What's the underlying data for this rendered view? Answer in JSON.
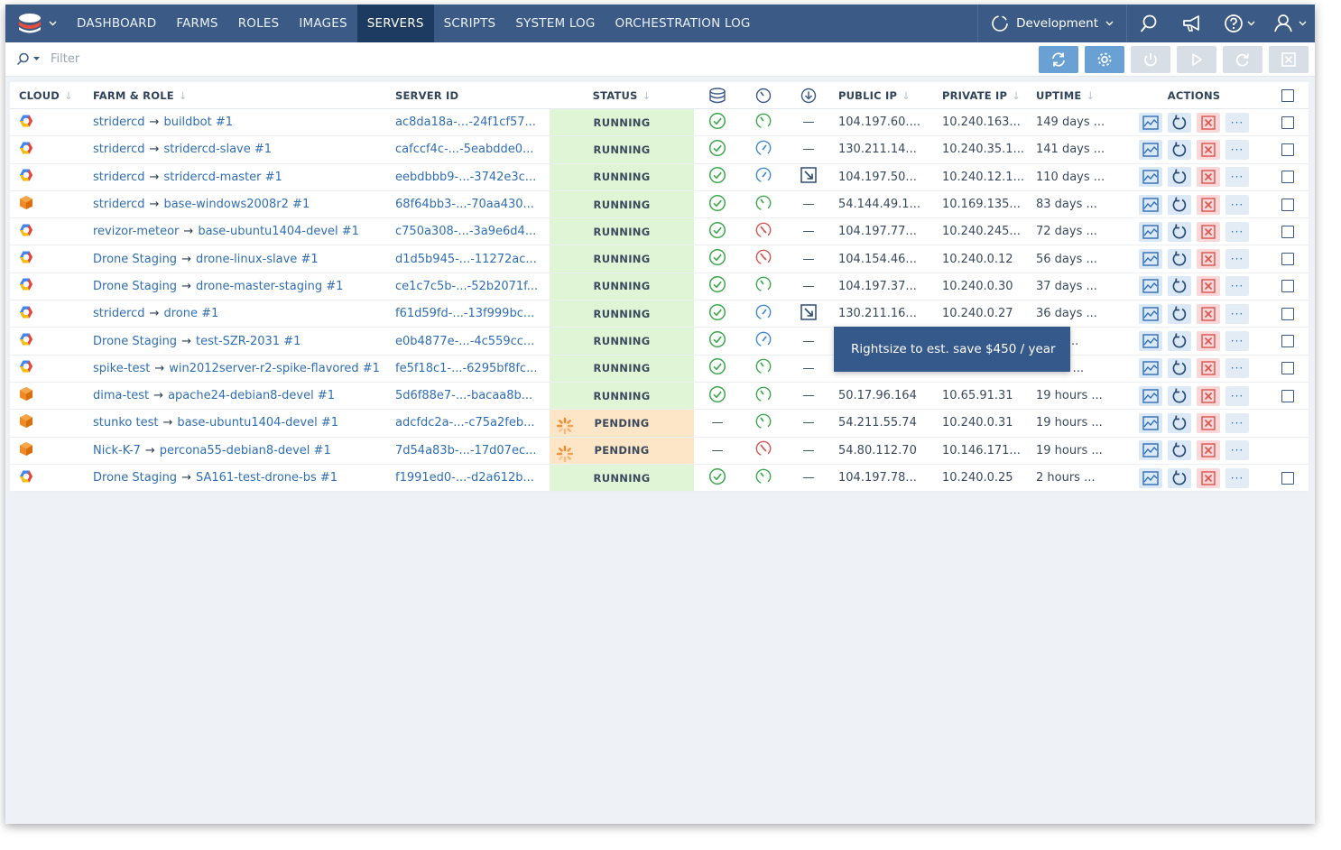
{
  "colors": {
    "nav_bg": "#3b5a85",
    "nav_active": "#1d3a61",
    "link": "#2f6eb5",
    "running_bg": "#dff5d6",
    "pending_bg": "#fde5c7",
    "ok_green": "#3aa84a",
    "warn_red": "#d9534f",
    "info_blue": "#3d8ad6"
  },
  "nav": {
    "items": [
      "DASHBOARD",
      "FARMS",
      "ROLES",
      "IMAGES",
      "SERVERS",
      "SCRIPTS",
      "SYSTEM LOG",
      "ORCHESTRATION LOG"
    ],
    "active": "SERVERS",
    "environment": "Development"
  },
  "filter": {
    "placeholder": "Filter"
  },
  "columns": {
    "cloud": "CLOUD",
    "farm_role": "FARM & ROLE",
    "server_id": "SERVER ID",
    "status": "STATUS",
    "public_ip": "PUBLIC IP",
    "private_ip": "PRIVATE IP",
    "uptime": "UPTIME",
    "actions": "ACTIONS"
  },
  "rows": [
    {
      "cloud": "gce",
      "farm": "stridercd",
      "role": "buildbot #1",
      "id": "ac8da18a-...-24f1cf57...",
      "status": "RUNNING",
      "db": "ok",
      "gauge": "green",
      "dl": "—",
      "pub": "104.197.60....",
      "priv": "10.240.163...",
      "up": "149 days ...",
      "checkbox": true
    },
    {
      "cloud": "gce",
      "farm": "stridercd",
      "role": "stridercd-slave #1",
      "id": "cafccf4c-...-5eabdde0...",
      "status": "RUNNING",
      "db": "ok",
      "gauge": "blue",
      "dl": "—",
      "pub": "130.211.14...",
      "priv": "10.240.35.1...",
      "up": "141 days ...",
      "checkbox": true
    },
    {
      "cloud": "gce",
      "farm": "stridercd",
      "role": "stridercd-master #1",
      "id": "eebdbbb9-...-3742e3c...",
      "status": "RUNNING",
      "db": "ok",
      "gauge": "blue",
      "dl": "rightsize",
      "pub": "104.197.50...",
      "priv": "10.240.12.1...",
      "up": "110 days ...",
      "checkbox": true
    },
    {
      "cloud": "ec2",
      "farm": "stridercd",
      "role": "base-windows2008r2 #1",
      "id": "68f64bb3-...-70aa430...",
      "status": "RUNNING",
      "db": "ok",
      "gauge": "green",
      "dl": "—",
      "pub": "54.144.49.1...",
      "priv": "10.169.135...",
      "up": "83 days ...",
      "checkbox": true
    },
    {
      "cloud": "gce",
      "farm": "revizor-meteor",
      "role": "base-ubuntu1404-devel #1",
      "id": "c750a308-...-3a9e6d4...",
      "status": "RUNNING",
      "db": "ok",
      "gauge": "red",
      "dl": "—",
      "pub": "104.197.77...",
      "priv": "10.240.245...",
      "up": "72 days ...",
      "checkbox": true
    },
    {
      "cloud": "gce",
      "farm": "Drone Staging",
      "role": "drone-linux-slave #1",
      "id": "d1d5b945-...-11272ac...",
      "status": "RUNNING",
      "db": "ok",
      "gauge": "red",
      "dl": "—",
      "pub": "104.154.46...",
      "priv": "10.240.0.12",
      "up": "56 days ...",
      "checkbox": true
    },
    {
      "cloud": "gce",
      "farm": "Drone Staging",
      "role": "drone-master-staging #1",
      "id": "ce1c7c5b-...-52b2071f...",
      "status": "RUNNING",
      "db": "ok",
      "gauge": "green",
      "dl": "—",
      "pub": "104.197.37...",
      "priv": "10.240.0.30",
      "up": "37 days ...",
      "checkbox": true
    },
    {
      "cloud": "gce",
      "farm": "stridercd",
      "role": "drone #1",
      "id": "f61d59fd-...-13f999bc...",
      "status": "RUNNING",
      "db": "ok",
      "gauge": "blue",
      "dl": "rightsize",
      "pub": "130.211.16...",
      "priv": "10.240.0.27",
      "up": "36 days ...",
      "checkbox": true
    },
    {
      "cloud": "gce",
      "farm": "Drone Staging",
      "role": "test-SZR-2031 #1",
      "id": "e0b4877e-...-4c559cc...",
      "status": "RUNNING",
      "db": "ok",
      "gauge": "blue",
      "dl": "—",
      "pub": "",
      "priv": "",
      "up": "days ...",
      "checkbox": true
    },
    {
      "cloud": "gce",
      "farm": "spike-test",
      "role": "win2012server-r2-spike-flavored #1",
      "id": "fe5f18c1-...-6295bf8fc...",
      "status": "RUNNING",
      "db": "ok",
      "gauge": "green",
      "dl": "—",
      "pub": "",
      "priv": "",
      "up": "hours ...",
      "checkbox": true
    },
    {
      "cloud": "ec2",
      "farm": "dima-test",
      "role": "apache24-debian8-devel #1",
      "id": "5d6f88e7-...-bacaa8b...",
      "status": "RUNNING",
      "db": "ok",
      "gauge": "green",
      "dl": "—",
      "pub": "50.17.96.164",
      "priv": "10.65.91.31",
      "up": "19 hours ...",
      "checkbox": true
    },
    {
      "cloud": "ec2",
      "farm": "stunko test",
      "role": "base-ubuntu1404-devel #1",
      "id": "adcfdc2a-...-c75a2feb...",
      "status": "PENDING",
      "db": "—",
      "gauge": "green",
      "dl": "—",
      "pub": "54.211.55.74",
      "priv": "10.240.0.31",
      "up": "19 hours ...",
      "checkbox": false
    },
    {
      "cloud": "ec2",
      "farm": "Nick-K-7",
      "role": "percona55-debian8-devel #1",
      "id": "7d54a83b-...-17d07ec...",
      "status": "PENDING",
      "db": "—",
      "gauge": "red",
      "dl": "—",
      "pub": "54.80.112.70",
      "priv": "10.146.171...",
      "up": "19 hours ...",
      "checkbox": false
    },
    {
      "cloud": "gce",
      "farm": "Drone Staging",
      "role": "SA161-test-drone-bs #1",
      "id": "f1991ed0-...-d2a612b...",
      "status": "RUNNING",
      "db": "ok",
      "gauge": "green",
      "dl": "—",
      "pub": "104.197.78...",
      "priv": "10.240.0.25",
      "up": "2 hours ...",
      "checkbox": true
    }
  ],
  "tooltip": {
    "text": "Rightsize to est. save $450 / year"
  }
}
